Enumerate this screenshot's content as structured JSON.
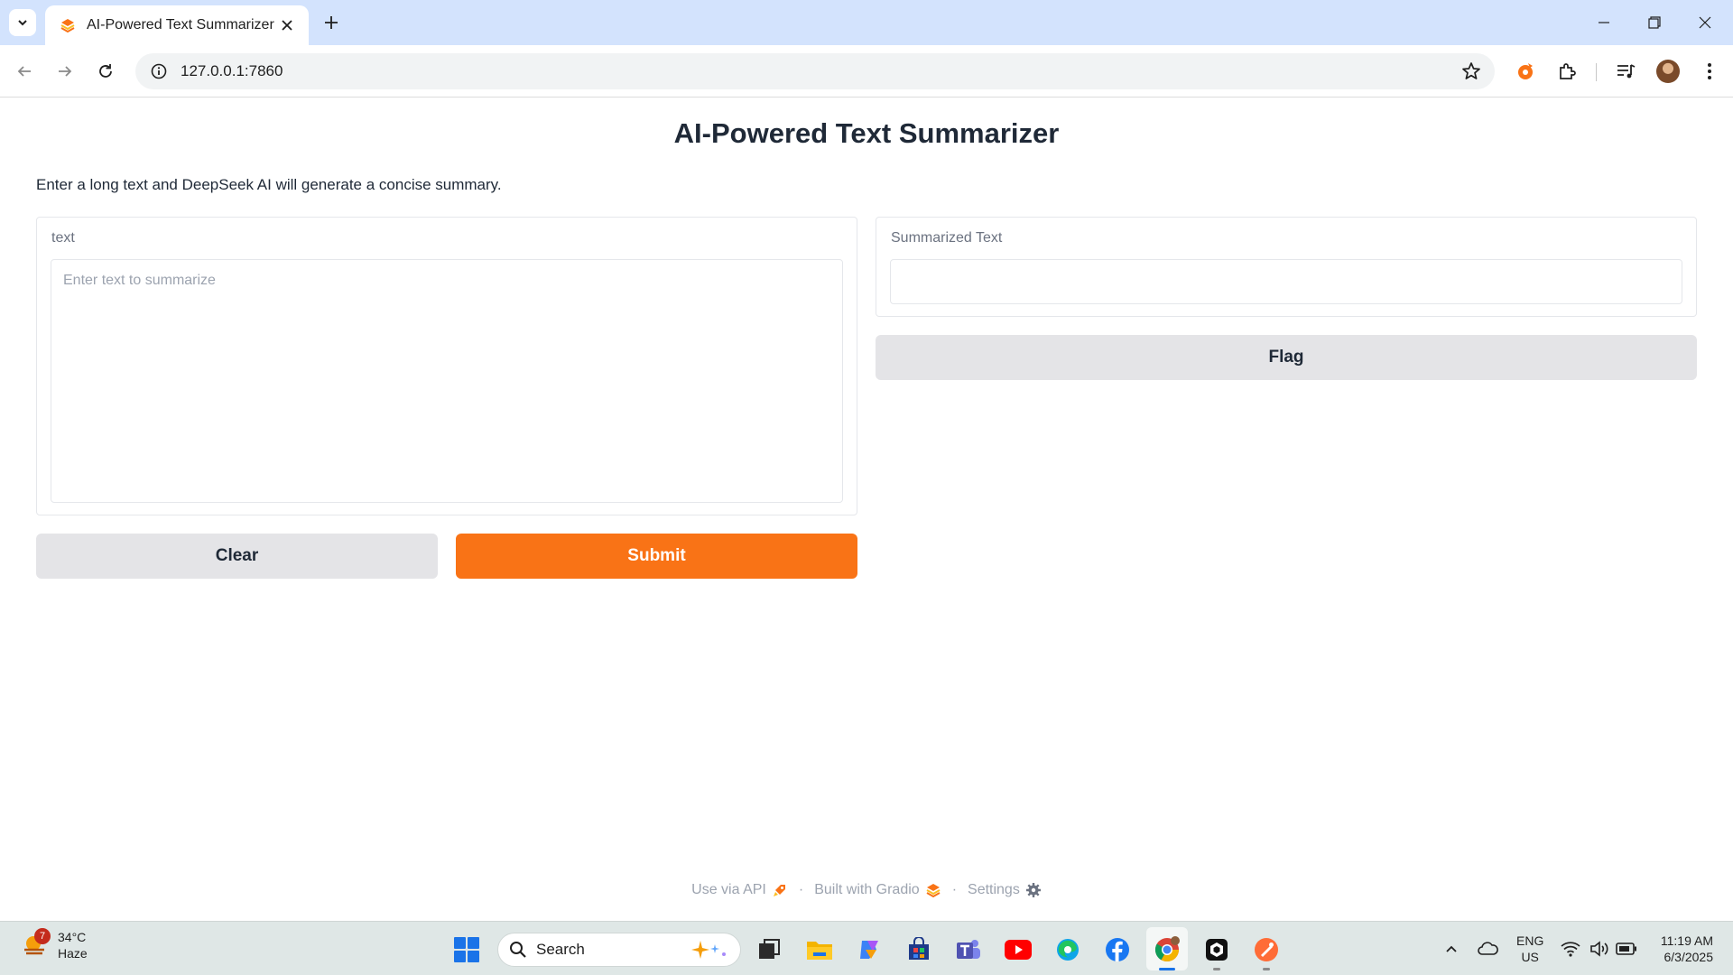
{
  "browser": {
    "tab_title": "AI-Powered Text Summarizer",
    "url": "127.0.0.1:7860"
  },
  "app": {
    "title": "AI-Powered Text Summarizer",
    "description": "Enter a long text and DeepSeek AI will generate a concise summary.",
    "input": {
      "label": "text",
      "placeholder": "Enter text to summarize",
      "value": ""
    },
    "output": {
      "label": "Summarized Text",
      "value": ""
    },
    "buttons": {
      "clear": "Clear",
      "submit": "Submit",
      "flag": "Flag"
    },
    "colors": {
      "primary": "#f97316",
      "secondary": "#e4e4e7"
    }
  },
  "footer": {
    "api": "Use via API",
    "built": "Built with Gradio",
    "settings": "Settings",
    "separator": "·"
  },
  "taskbar": {
    "weather": {
      "temp": "34°C",
      "condition": "Haze",
      "badge": "7"
    },
    "search_label": "Search",
    "language": "ENG",
    "region": "US",
    "time": "11:19 AM",
    "date": "6/3/2025"
  }
}
